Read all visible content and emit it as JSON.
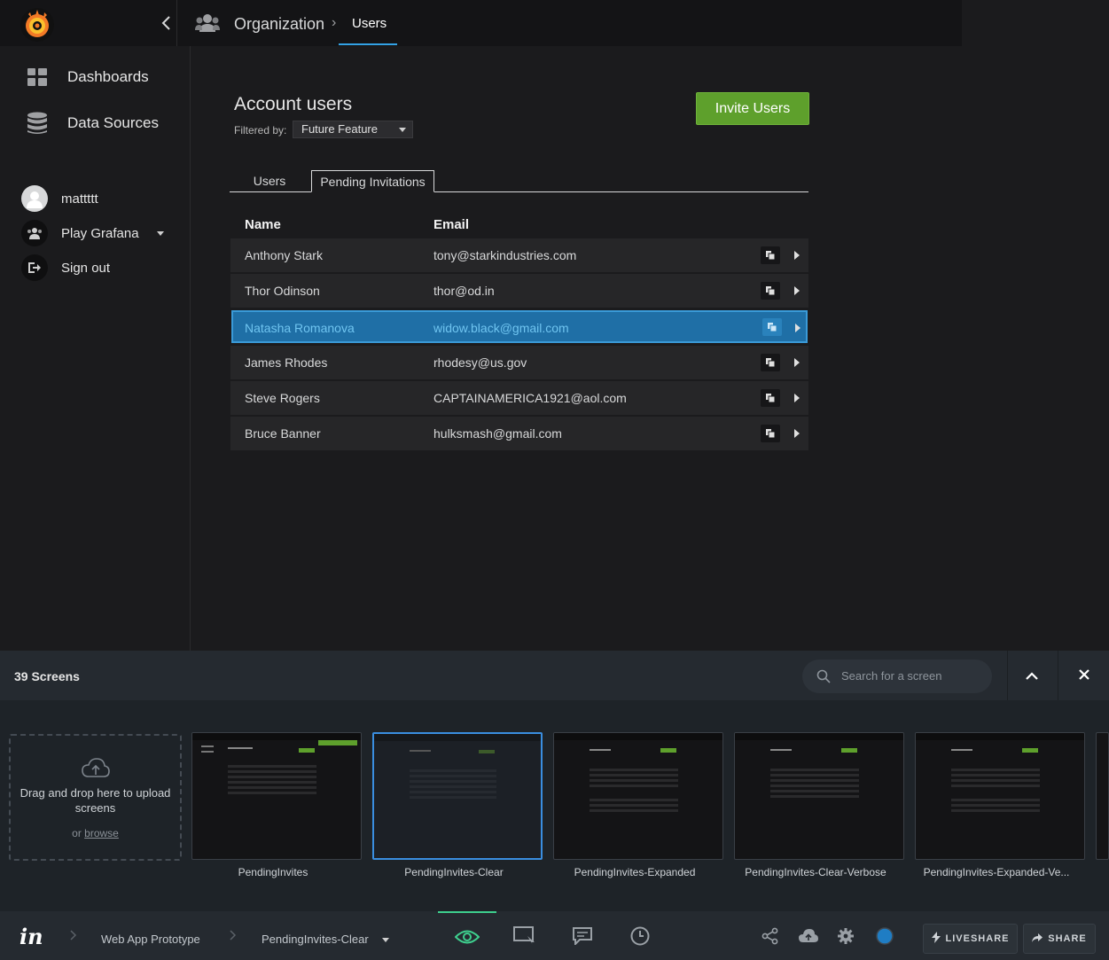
{
  "topbar": {
    "breadcrumb_org": "Organization",
    "breadcrumb_sep": "›",
    "breadcrumb_users": "Users",
    "collapse_icon": "chevron-left-icon"
  },
  "sidebar": {
    "items": [
      {
        "label": "Dashboards",
        "icon": "dashboard-grid-icon"
      },
      {
        "label": "Data Sources",
        "icon": "database-icon"
      }
    ],
    "user_name": "mattttt",
    "org_name": "Play Grafana",
    "sign_out": "Sign out"
  },
  "main": {
    "title": "Account users",
    "filter_label": "Filtered by:",
    "filter_value": "Future Feature",
    "invite_button": "Invite Users",
    "tabs": [
      {
        "label": "Users",
        "active": false
      },
      {
        "label": "Pending Invitations",
        "active": true
      }
    ],
    "columns": {
      "name": "Name",
      "email": "Email"
    },
    "rows": [
      {
        "name": "Anthony Stark",
        "email": "tony@starkindustries.com",
        "selected": false
      },
      {
        "name": "Thor Odinson",
        "email": "thor@od.in",
        "selected": false
      },
      {
        "name": "Natasha Romanova",
        "email": "widow.black@gmail.com",
        "selected": true
      },
      {
        "name": "James Rhodes",
        "email": "rhodesy@us.gov",
        "selected": false
      },
      {
        "name": "Steve Rogers",
        "email": "CAPTAINAMERICA1921@aol.com",
        "selected": false
      },
      {
        "name": "Bruce Banner",
        "email": "hulksmash@gmail.com",
        "selected": false
      }
    ]
  },
  "screens_panel": {
    "title": "39 Screens",
    "search_placeholder": "Search for a screen",
    "drop_text": "Drag and drop here to upload screens",
    "drop_or": "or",
    "drop_browse": "browse",
    "screens": [
      {
        "label": "PendingInvites",
        "active": false
      },
      {
        "label": "PendingInvites-Clear",
        "active": true
      },
      {
        "label": "PendingInvites-Expanded",
        "active": false
      },
      {
        "label": "PendingInvites-Clear-Verbose",
        "active": false
      },
      {
        "label": "PendingInvites-Expanded-Ve...",
        "active": false
      }
    ]
  },
  "bottombar": {
    "project": "Web App Prototype",
    "screen": "PendingInvites-Clear",
    "liveshare": "LIVESHARE",
    "share": "SHARE",
    "colors": {
      "accent_green": "#3ecf8e",
      "status_dot": "#1f7dc4"
    }
  },
  "colors": {
    "invite_green": "#5ea02c",
    "selection_blue": "#1f6fa6",
    "tab_underline": "#33a2e5"
  }
}
